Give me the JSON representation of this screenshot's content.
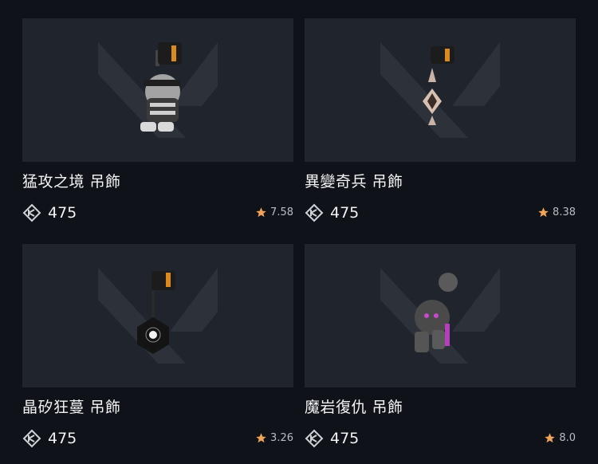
{
  "items": [
    {
      "name": "猛攻之境 吊飾",
      "price": "475",
      "rating": "7.58"
    },
    {
      "name": "異變奇兵 吊飾",
      "price": "475",
      "rating": "8.38"
    },
    {
      "name": "晶矽狂蔓 吊飾",
      "price": "475",
      "rating": "3.26"
    },
    {
      "name": "魔岩復仇 吊飾",
      "price": "475",
      "rating": "8.0"
    }
  ],
  "icons": {
    "currency": "valorant-points-icon",
    "rating": "star-icon"
  },
  "colors": {
    "background": "#0f1218",
    "card": "#20242c",
    "star": "#f0a35a"
  }
}
